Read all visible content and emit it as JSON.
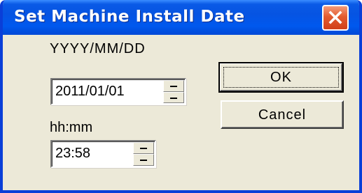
{
  "window": {
    "title": "Set Machine Install Date"
  },
  "date": {
    "label": "YYYY/MM/DD",
    "value": "2011/01/01"
  },
  "time": {
    "label": "hh:mm",
    "value": "23:58"
  },
  "buttons": {
    "ok_label": "OK",
    "cancel_label": "Cancel"
  },
  "icons": {
    "close": "close-icon",
    "spin_up": "spin-up-icon",
    "spin_down": "spin-down-icon"
  },
  "colors": {
    "titlebar": "#0054e3",
    "close_button": "#e04a1f",
    "dialog_face": "#ece9d8"
  }
}
